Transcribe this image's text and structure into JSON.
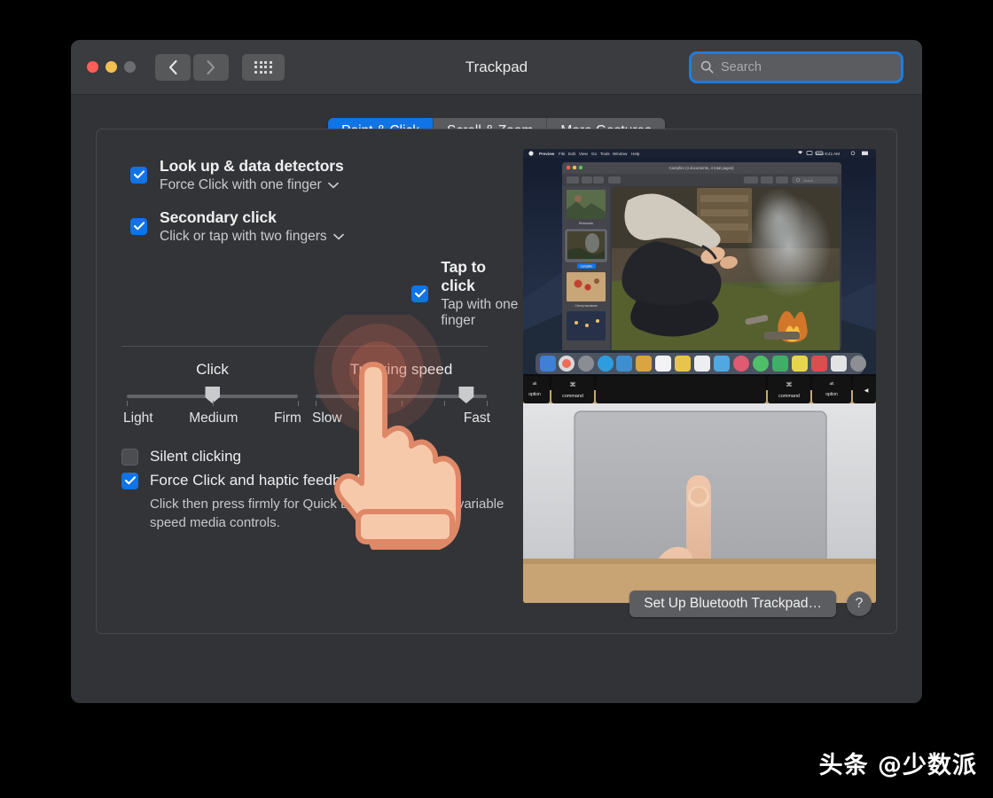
{
  "window": {
    "title": "Trackpad",
    "traffic_lights": [
      "close",
      "minimize",
      "zoom"
    ],
    "nav": {
      "back": "back-arrow",
      "forward": "forward-arrow",
      "grid": "show-all-grid"
    },
    "search": {
      "placeholder": "Search",
      "value": "",
      "icon": "search-icon"
    }
  },
  "tabs": [
    {
      "label": "Point & Click",
      "active": true
    },
    {
      "label": "Scroll & Zoom",
      "active": false
    },
    {
      "label": "More Gestures",
      "active": false
    }
  ],
  "options": [
    {
      "title": "Look up & data detectors",
      "subtitle": "Force Click with one finger",
      "checked": true,
      "has_dropdown": true,
      "highlighted": false
    },
    {
      "title": "Secondary click",
      "subtitle": "Click or tap with two fingers",
      "checked": true,
      "has_dropdown": true,
      "highlighted": false
    },
    {
      "title": "Tap to click",
      "subtitle": "Tap with one finger",
      "checked": true,
      "has_dropdown": false,
      "highlighted": true
    }
  ],
  "sliders": [
    {
      "title": "Click",
      "labels": [
        "Light",
        "Medium",
        "Firm"
      ],
      "value": "Medium",
      "position_pct": 50,
      "tick_count": 3
    },
    {
      "title": "Tracking speed",
      "labels": [
        "Slow",
        "Fast"
      ],
      "value": "",
      "position_pct": 88,
      "tick_count": 5
    }
  ],
  "bottom_checks": [
    {
      "label": "Silent clicking",
      "checked": false,
      "description": ""
    },
    {
      "label": "Force Click and haptic feedback",
      "checked": true,
      "description": "Click then press firmly for Quick Look, Look up, and variable speed media controls."
    }
  ],
  "footer": {
    "bluetooth_button": "Set Up Bluetooth Trackpad…",
    "help_button": "?"
  },
  "preview": {
    "description": "macOS desktop demo video: Preview app with campfire photo above a MacBook keyboard and trackpad with a finger tapping",
    "menu_items": [
      "Preview",
      "File",
      "Edit",
      "View",
      "Go",
      "Tools",
      "Window",
      "Help"
    ],
    "menubar_clock": "Mon 9:41 AM",
    "doc_title": "Campfire (4 documents, 4 total pages)",
    "sidebar_captions": [
      "Redwoods",
      "Campfire",
      "Cherry tomatoes",
      ""
    ],
    "selected_thumb": "Campfire",
    "keys": [
      "alt option",
      "command",
      "",
      "command",
      "alt option"
    ]
  },
  "cursor": {
    "type": "pointing-hand",
    "tap_ripple": true
  },
  "watermark": "头条 @少数派",
  "colors": {
    "accent_blue": "#1073e6",
    "window_bg": "#323336",
    "panel_bg": "#333438",
    "titlebar_bg": "#3b3c3f",
    "highlight_band": "#6d6e71",
    "text_primary": "#f0f0f1",
    "text_secondary": "#c9cacb"
  }
}
